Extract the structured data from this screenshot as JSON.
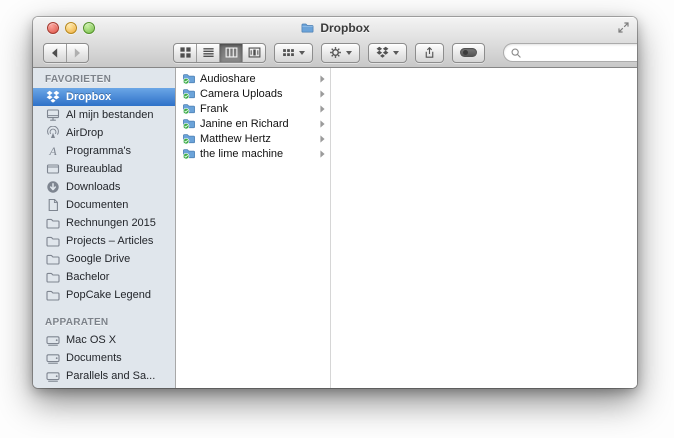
{
  "window": {
    "title": "Dropbox",
    "title_icon": "folder-icon",
    "controls": [
      "close",
      "minimize",
      "zoom"
    ],
    "fullscreen_icon": "fullscreen-arrows-icon"
  },
  "toolbar": {
    "nav": {
      "back": "back-arrow-icon",
      "forward": "forward-arrow-icon"
    },
    "view_modes": [
      {
        "name": "icon-view",
        "selected": false
      },
      {
        "name": "list-view",
        "selected": false
      },
      {
        "name": "column-view",
        "selected": true
      },
      {
        "name": "coverflow-view",
        "selected": false
      }
    ],
    "menus": [
      {
        "name": "arrange-menu",
        "icon": "arrange-grid-icon"
      },
      {
        "name": "action-menu",
        "icon": "gear-icon"
      },
      {
        "name": "dropbox-menu",
        "icon": "dropbox-icon"
      }
    ],
    "buttons": [
      {
        "name": "share-button",
        "icon": "share-icon"
      },
      {
        "name": "tag-button",
        "icon": "tag-pill-icon"
      }
    ],
    "search": {
      "placeholder": "",
      "value": "",
      "icon": "search-icon"
    }
  },
  "sidebar": {
    "sections": [
      {
        "label": "FAVORIETEN",
        "items": [
          {
            "label": "Dropbox",
            "icon": "dropbox-icon",
            "selected": true
          },
          {
            "label": "Al mijn bestanden",
            "icon": "all-my-files-icon"
          },
          {
            "label": "AirDrop",
            "icon": "airdrop-icon"
          },
          {
            "label": "Programma's",
            "icon": "applications-icon"
          },
          {
            "label": "Bureaublad",
            "icon": "desktop-icon"
          },
          {
            "label": "Downloads",
            "icon": "downloads-icon"
          },
          {
            "label": "Documenten",
            "icon": "documents-icon"
          },
          {
            "label": "Rechnungen 2015",
            "icon": "folder-icon"
          },
          {
            "label": "Projects – Articles",
            "icon": "folder-icon"
          },
          {
            "label": "Google Drive",
            "icon": "folder-icon"
          },
          {
            "label": "Bachelor",
            "icon": "folder-icon"
          },
          {
            "label": "PopCake Legend",
            "icon": "folder-icon"
          }
        ]
      },
      {
        "label": "APPARATEN",
        "items": [
          {
            "label": "Mac OS X",
            "icon": "hard-drive-icon"
          },
          {
            "label": "Documents",
            "icon": "hard-drive-icon"
          },
          {
            "label": "Parallels and Sa...",
            "icon": "hard-drive-icon"
          }
        ]
      }
    ]
  },
  "column_view": {
    "items": [
      {
        "label": "Audioshare",
        "icon": "synced-folder-icon",
        "expandable": true
      },
      {
        "label": "Camera Uploads",
        "icon": "synced-folder-icon",
        "expandable": true
      },
      {
        "label": "Frank",
        "icon": "synced-folder-icon",
        "expandable": true
      },
      {
        "label": "Janine en Richard",
        "icon": "synced-folder-icon",
        "expandable": true
      },
      {
        "label": "Matthew Hertz",
        "icon": "synced-folder-icon",
        "expandable": true
      },
      {
        "label": "the lime machine",
        "icon": "synced-folder-icon",
        "expandable": true
      }
    ]
  },
  "colors": {
    "selection_blue_top": "#6ba6e6",
    "selection_blue_bottom": "#2e71c8",
    "sidebar_bg": "#e0e6ec",
    "chrome_top": "#f4f4f4",
    "chrome_bottom": "#c8c8c8",
    "folder_blue": "#6ba3d9",
    "sync_badge_green": "#3fae49",
    "traffic_red": "#dd5144",
    "traffic_yellow": "#efab3b",
    "traffic_green": "#74bd46"
  }
}
